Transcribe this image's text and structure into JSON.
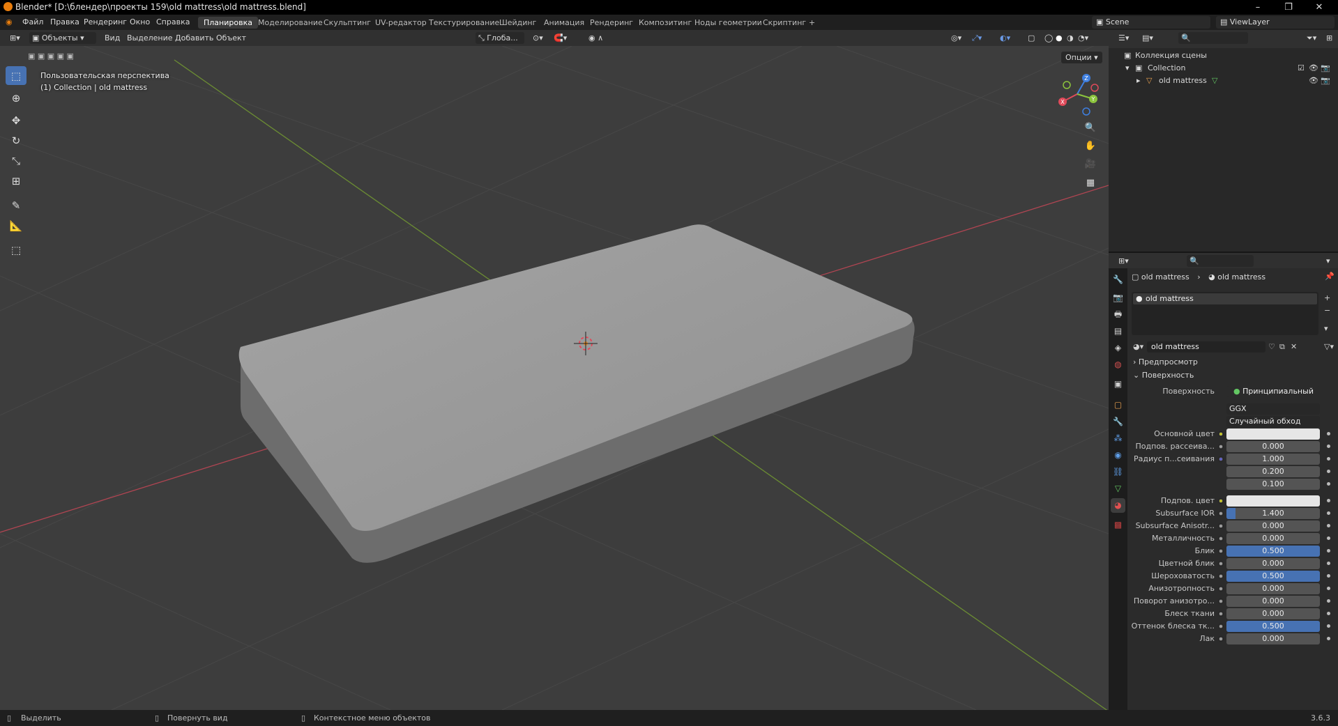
{
  "window": {
    "title": "Blender* [D:\\блендер\\проекты 159\\old mattress\\old mattress.blend]",
    "minimize": "–",
    "maximize": "❐",
    "close": "✕"
  },
  "menu": [
    "Файл",
    "Правка",
    "Рендеринг",
    "Окно",
    "Справка"
  ],
  "workspaces": [
    "Планировка",
    "Моделирование",
    "Скульптинг",
    "UV-редактор",
    "Текстурирование",
    "Шейдинг",
    "Анимация",
    "Рендеринг",
    "Композитинг",
    "Ноды геометрии",
    "Скриптинг",
    "+"
  ],
  "scene": {
    "scene_name": "Scene",
    "view_layer": "ViewLayer"
  },
  "viewport_header": {
    "mode": "Объекты",
    "menus": [
      "Вид",
      "Выделение",
      "Добавить",
      "Объект"
    ],
    "orientation": "Глоба...",
    "options": "Опции"
  },
  "viewport": {
    "view_name": "Пользовательская перспектива",
    "collection_info": "(1) Collection | old mattress",
    "gizmo_axes": [
      "X",
      "Y",
      "Z"
    ]
  },
  "outliner": {
    "root": "Коллекция сцены",
    "collection": "Collection",
    "object": "old mattress"
  },
  "properties": {
    "breadcrumb_object": "old mattress",
    "breadcrumb_material": "old mattress",
    "material_slot": "old mattress",
    "material_name": "old mattress",
    "panel_preview": "Предпросмотр",
    "panel_surface": "Поверхность",
    "surface_label": "Поверхность",
    "surface_shader": "Принципиальный BSDF",
    "distribution": "GGX",
    "subsurface_method": "Случайный обход",
    "rows": [
      {
        "label": "Основной цвет",
        "type": "color",
        "value": "",
        "color": "#e6e6e6"
      },
      {
        "label": "Подпов. рассеива...",
        "type": "num",
        "value": "0.000",
        "fill": 0
      },
      {
        "label": "Радиус п...сеивания",
        "type": "num",
        "value": "1.000",
        "fill": 0
      },
      {
        "label": "",
        "type": "num",
        "value": "0.200",
        "fill": 0
      },
      {
        "label": "",
        "type": "num",
        "value": "0.100",
        "fill": 0
      },
      {
        "label": "Подпов. цвет",
        "type": "color",
        "value": "",
        "color": "#e6e6e6"
      },
      {
        "label": "Subsurface IOR",
        "type": "num",
        "value": "1.400",
        "fill": 0.1
      },
      {
        "label": "Subsurface Anisotr...",
        "type": "num",
        "value": "0.000",
        "fill": 0
      },
      {
        "label": "Металличность",
        "type": "num",
        "value": "0.000",
        "fill": 0
      },
      {
        "label": "Блик",
        "type": "num",
        "value": "0.500",
        "fill": 1
      },
      {
        "label": "Цветной блик",
        "type": "num",
        "value": "0.000",
        "fill": 0
      },
      {
        "label": "Шероховатость",
        "type": "num",
        "value": "0.500",
        "fill": 1
      },
      {
        "label": "Анизотропность",
        "type": "num",
        "value": "0.000",
        "fill": 0
      },
      {
        "label": "Поворот анизотро...",
        "type": "num",
        "value": "0.000",
        "fill": 0
      },
      {
        "label": "Блеск ткани",
        "type": "num",
        "value": "0.000",
        "fill": 0
      },
      {
        "label": "Оттенок блеска тк...",
        "type": "num",
        "value": "0.500",
        "fill": 1
      },
      {
        "label": "Лак",
        "type": "num",
        "value": "0.000",
        "fill": 0
      }
    ]
  },
  "status": {
    "select": "Выделить",
    "rotate": "Повернуть вид",
    "context": "Контекстное меню объектов",
    "version": "3.6.3"
  },
  "colors": {
    "accent": "#4772b3",
    "x_axis": "#e04a5a",
    "y_axis": "#8cc43d",
    "z_axis": "#3e7fe0"
  }
}
